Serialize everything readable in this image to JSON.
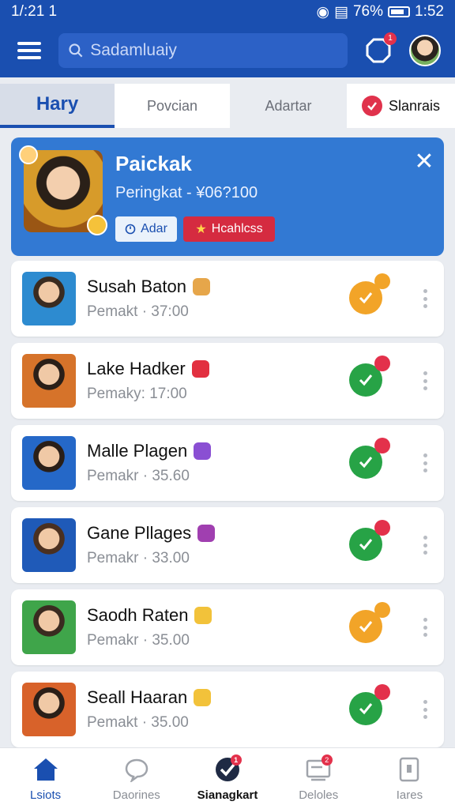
{
  "status_bar": {
    "time": "1/:21 1",
    "battery": "76%",
    "clock": "1:52"
  },
  "header": {
    "search_placeholder": "Sadamluaiy",
    "notification_count": "1"
  },
  "tabs": [
    {
      "label": "Hary"
    },
    {
      "label": "Povcian"
    },
    {
      "label": "Adartar"
    },
    {
      "label": "Slanrais"
    }
  ],
  "featured": {
    "title": "Paickak",
    "subtitle": "Peringkat  - ¥06?100",
    "btn_primary": "Adar",
    "btn_secondary": "Hcahlcss"
  },
  "list": [
    {
      "name": "Susah Baton",
      "score": "Pemakt · 37:00",
      "status": "orange"
    },
    {
      "name": "Lake Hadker",
      "score": "Pemaky: 17:00",
      "status": "green"
    },
    {
      "name": "Malle Plagen",
      "score": "Pemakr · 35.60",
      "status": "green"
    },
    {
      "name": "Gane Pllages",
      "score": "Pemakr · 33.00",
      "status": "green"
    },
    {
      "name": "Saodh Raten",
      "score": "Pemakr · 35.00",
      "status": "orange"
    },
    {
      "name": "Seall Haaran",
      "score": "Pemakt · 35.00",
      "status": "green"
    }
  ],
  "bottom_nav": [
    {
      "label": "Lsiots",
      "icon": "home-icon"
    },
    {
      "label": "Daorines",
      "icon": "chat-icon"
    },
    {
      "label": "Sianagkart",
      "icon": "check-icon",
      "badge": "1"
    },
    {
      "label": "Deloles",
      "icon": "card-icon",
      "badge": "2"
    },
    {
      "label": "Iares",
      "icon": "phone-icon"
    }
  ],
  "colors": {
    "primary": "#1a4fb0",
    "accent_red": "#e3314b",
    "green": "#27a346",
    "orange": "#f2a428"
  }
}
